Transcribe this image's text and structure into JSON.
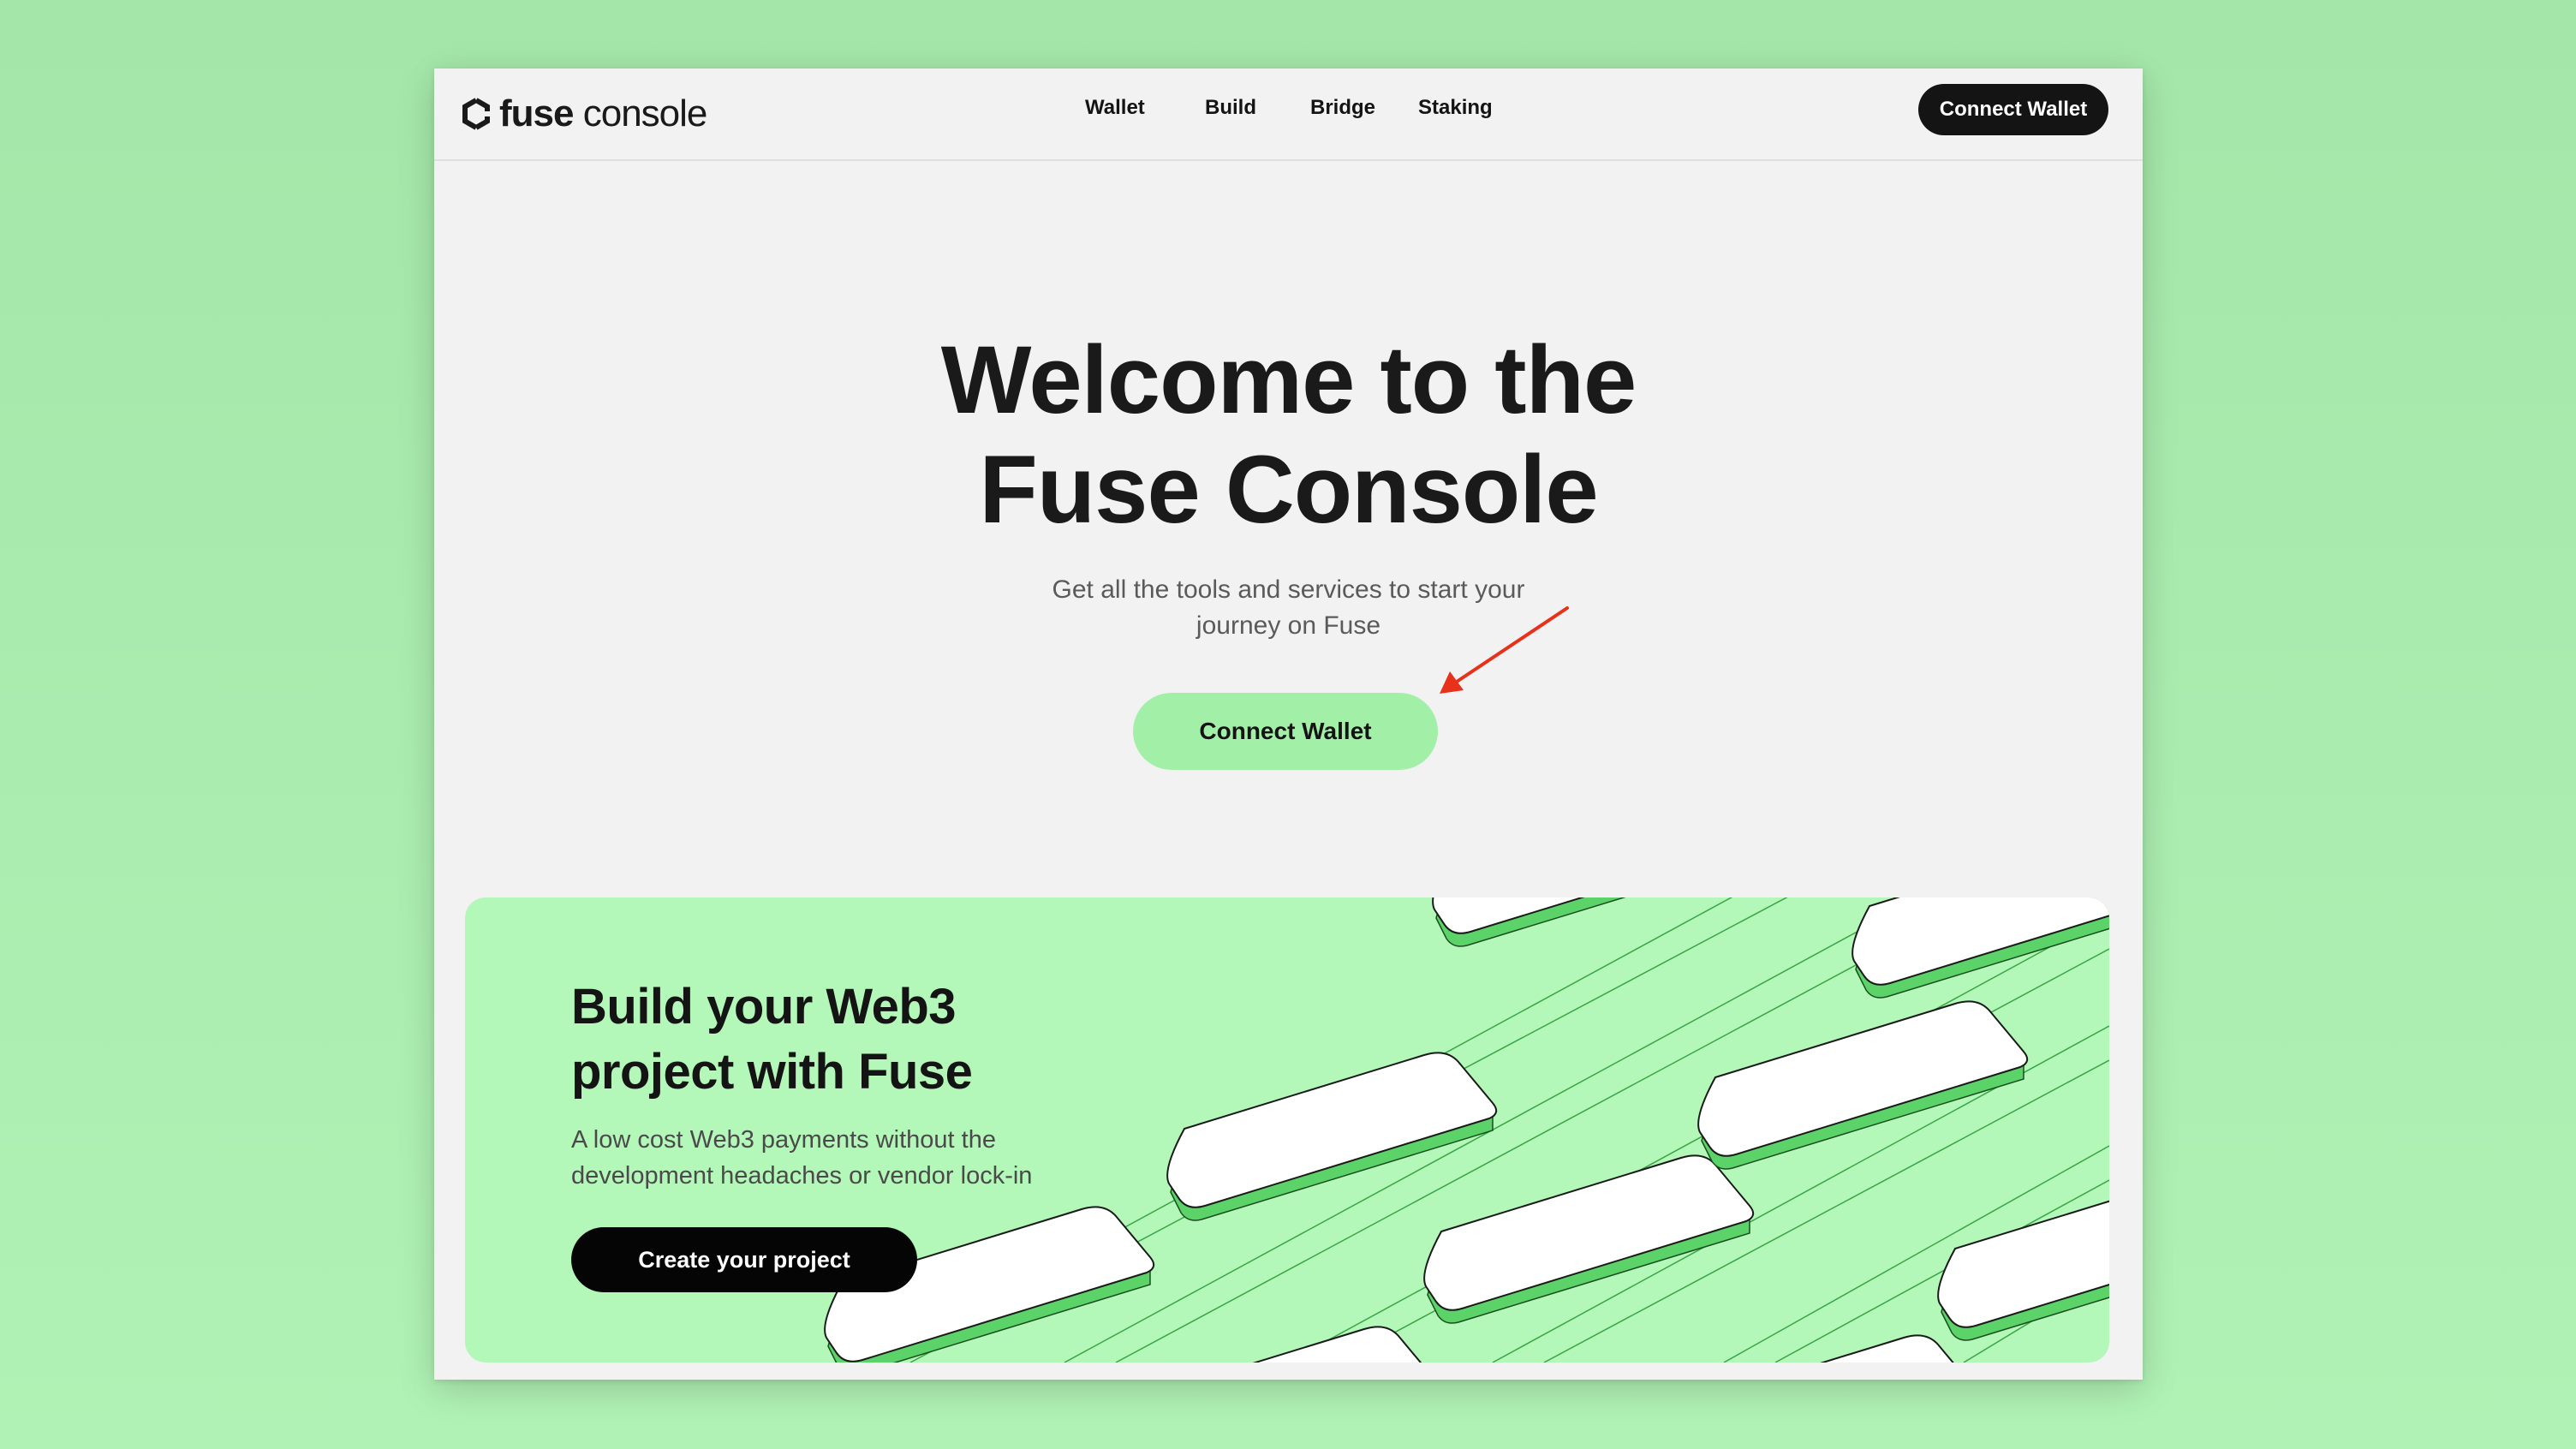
{
  "logo": {
    "icon": "fuse-logo-icon",
    "brand": "fuse",
    "product": "console"
  },
  "nav": {
    "items": [
      {
        "label": "Wallet"
      },
      {
        "label": "Build"
      },
      {
        "label": "Bridge"
      },
      {
        "label": "Staking"
      }
    ],
    "connect_label": "Connect Wallet"
  },
  "hero": {
    "title_lines": [
      "Welcome to the",
      "Fuse Console"
    ],
    "subtitle_lines": [
      "Get all the tools and services to start your",
      "journey on Fuse"
    ],
    "cta_label": "Connect Wallet",
    "annotation": "red-arrow-icon"
  },
  "promo": {
    "title_lines": [
      "Build your Web3",
      "project with Fuse"
    ],
    "subtitle_lines": [
      "A low cost Web3 payments without the",
      "development headaches or vendor lock-in"
    ],
    "cta_label": "Create your project"
  },
  "colors": {
    "page_bg": "#a8eaad",
    "window_bg": "#f2f2f2",
    "accent_green": "#a2f0a8",
    "promo_bg": "#b3f7b9",
    "dark": "#141414",
    "annotation_red": "#e8311a"
  }
}
